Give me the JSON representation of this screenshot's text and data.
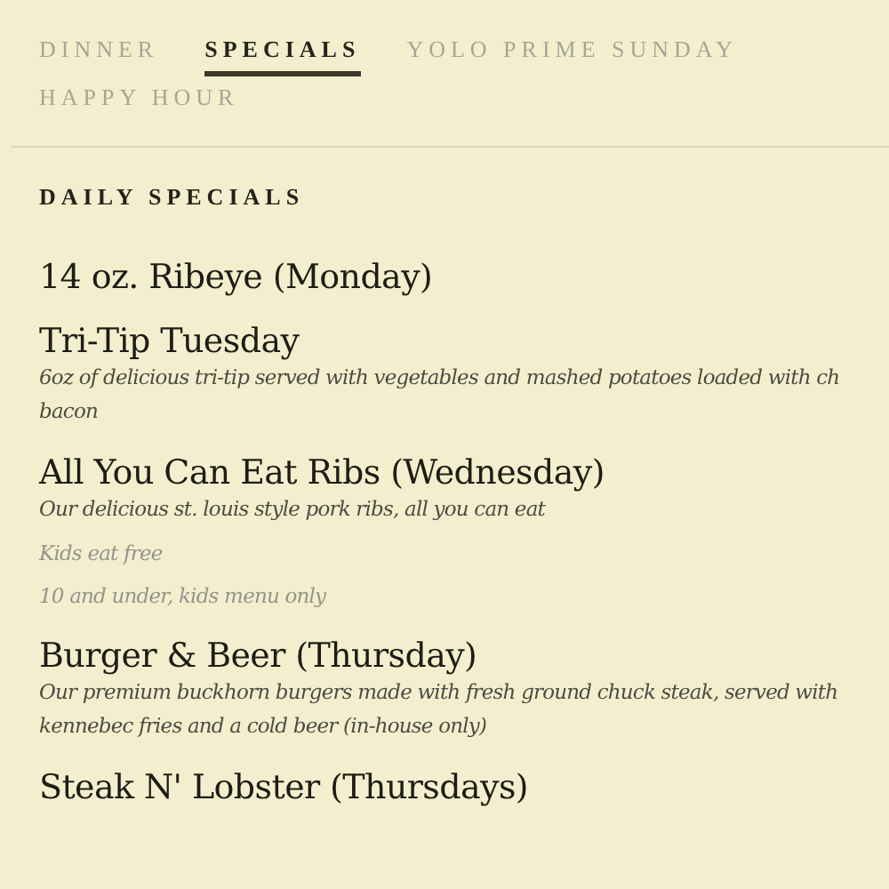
{
  "tabs": [
    {
      "label": "DINNER",
      "selected": false
    },
    {
      "label": "SPECIALS",
      "selected": true
    },
    {
      "label": "YOLO PRIME SUNDAY",
      "selected": false
    },
    {
      "label": "HAPPY HOUR",
      "selected": false
    }
  ],
  "section_title": "DAILY SPECIALS",
  "items": [
    {
      "title": "14 oz. Ribeye (Monday)"
    },
    {
      "title": "Tri-Tip Tuesday",
      "lines": [
        {
          "kind": "description",
          "text": "6oz of delicious tri-tip served with vegetables and mashed potatoes loaded with ch"
        },
        {
          "kind": "description",
          "text": "bacon"
        }
      ]
    },
    {
      "title": "All You Can Eat Ribs (Wednesday)",
      "lines": [
        {
          "kind": "description",
          "text": "Our delicious st. louis style pork ribs, all you can eat"
        },
        {
          "kind": "note",
          "text": "Kids eat free"
        },
        {
          "kind": "note",
          "text": "10 and under, kids menu only"
        }
      ]
    },
    {
      "title": "Burger & Beer (Thursday)",
      "lines": [
        {
          "kind": "description",
          "text": "Our premium buckhorn burgers made with fresh ground chuck steak, served with kennebec fries and a cold beer (in-house only)"
        }
      ]
    },
    {
      "title": "Steak N' Lobster (Thursdays)"
    }
  ]
}
